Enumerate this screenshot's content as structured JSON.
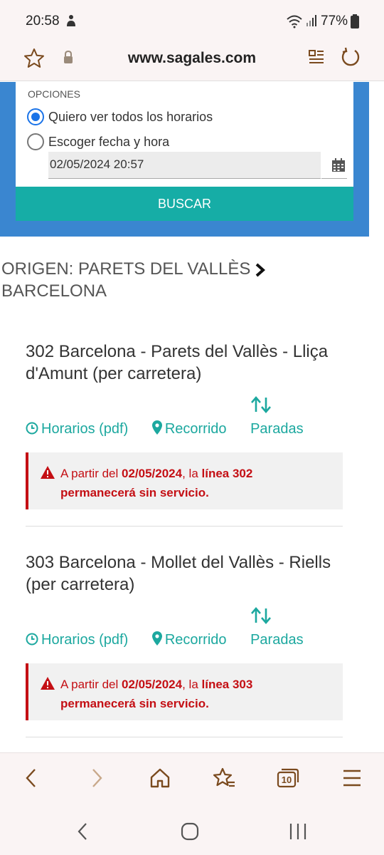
{
  "status": {
    "time": "20:58",
    "battery": "77%"
  },
  "browser": {
    "url": "www.sagales.com"
  },
  "form": {
    "section_label": "OPCIONES",
    "option_all": "Quiero ver todos los horarios",
    "option_date": "Escoger fecha y hora",
    "date_value": "02/05/2024 20:57",
    "search_button": "BUSCAR"
  },
  "route": {
    "origin_text": "ORIGEN: PARETS DEL VALLÈS",
    "destination_text": "BARCELONA"
  },
  "lines": [
    {
      "title": "302 Barcelona - Parets del Vallès - Lliça d'Amunt (per carretera)",
      "schedules": "Horarios (pdf)",
      "route": "Recorrido",
      "stops": "Paradas",
      "alert_prefix": "A partir del ",
      "alert_date": "02/05/2024",
      "alert_mid": ", la ",
      "alert_line": "línea 302",
      "alert_suffix": "permanecerá sin servicio."
    },
    {
      "title": "303 Barcelona - Mollet del Vallès - Riells (per carretera)",
      "schedules": "Horarios (pdf)",
      "route": "Recorrido",
      "stops": "Paradas",
      "alert_prefix": "A partir del ",
      "alert_date": "02/05/2024",
      "alert_mid": ", la ",
      "alert_line": "línea 303",
      "alert_suffix": "permanecerá sin servicio."
    }
  ],
  "tabs_count": "10",
  "colors": {
    "teal": "#16ada6",
    "blue": "#3a86d0",
    "alert_red": "#c40f14",
    "browser_brown": "#7a4a1e"
  }
}
